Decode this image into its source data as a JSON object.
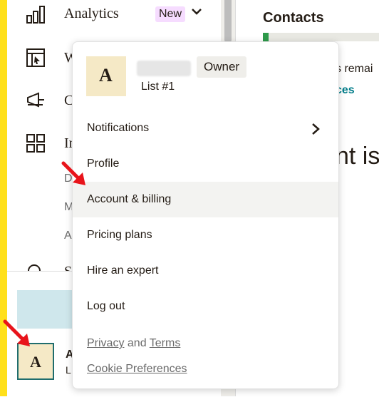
{
  "sidebar": {
    "items": [
      {
        "label": "Analytics",
        "badge": "New",
        "icon": "bar-chart-icon"
      },
      {
        "label": "W",
        "icon": "website-icon"
      },
      {
        "label": "C",
        "icon": "megaphone-icon"
      },
      {
        "label": "In",
        "icon": "grid-icon"
      },
      {
        "label": "S",
        "icon": "search-icon"
      }
    ],
    "sub_items": [
      "D",
      "M",
      "A"
    ],
    "account": {
      "avatar_letter": "A",
      "name_fragment": "A",
      "list_fragment": "L"
    }
  },
  "main": {
    "contacts_title": "Contacts",
    "remaining_fragment": "s remai",
    "link_fragment": "ces",
    "big_fragment": "nt is",
    "progress_fraction": 0.05
  },
  "dropdown": {
    "avatar_letter": "A",
    "owner_badge": "Owner",
    "list_name": "List #1",
    "menu": {
      "notifications": "Notifications",
      "profile": "Profile",
      "account_billing": "Account & billing",
      "pricing_plans": "Pricing plans",
      "hire_expert": "Hire an expert",
      "log_out": "Log out"
    },
    "footer": {
      "privacy": "Privacy",
      "and": "and",
      "terms": "Terms",
      "cookie": "Cookie Preferences"
    }
  },
  "colors": {
    "brand_yellow": "#ffe01b",
    "arrow_red": "#e8141b",
    "link_teal": "#007c89",
    "new_badge": "#f6dcff"
  }
}
